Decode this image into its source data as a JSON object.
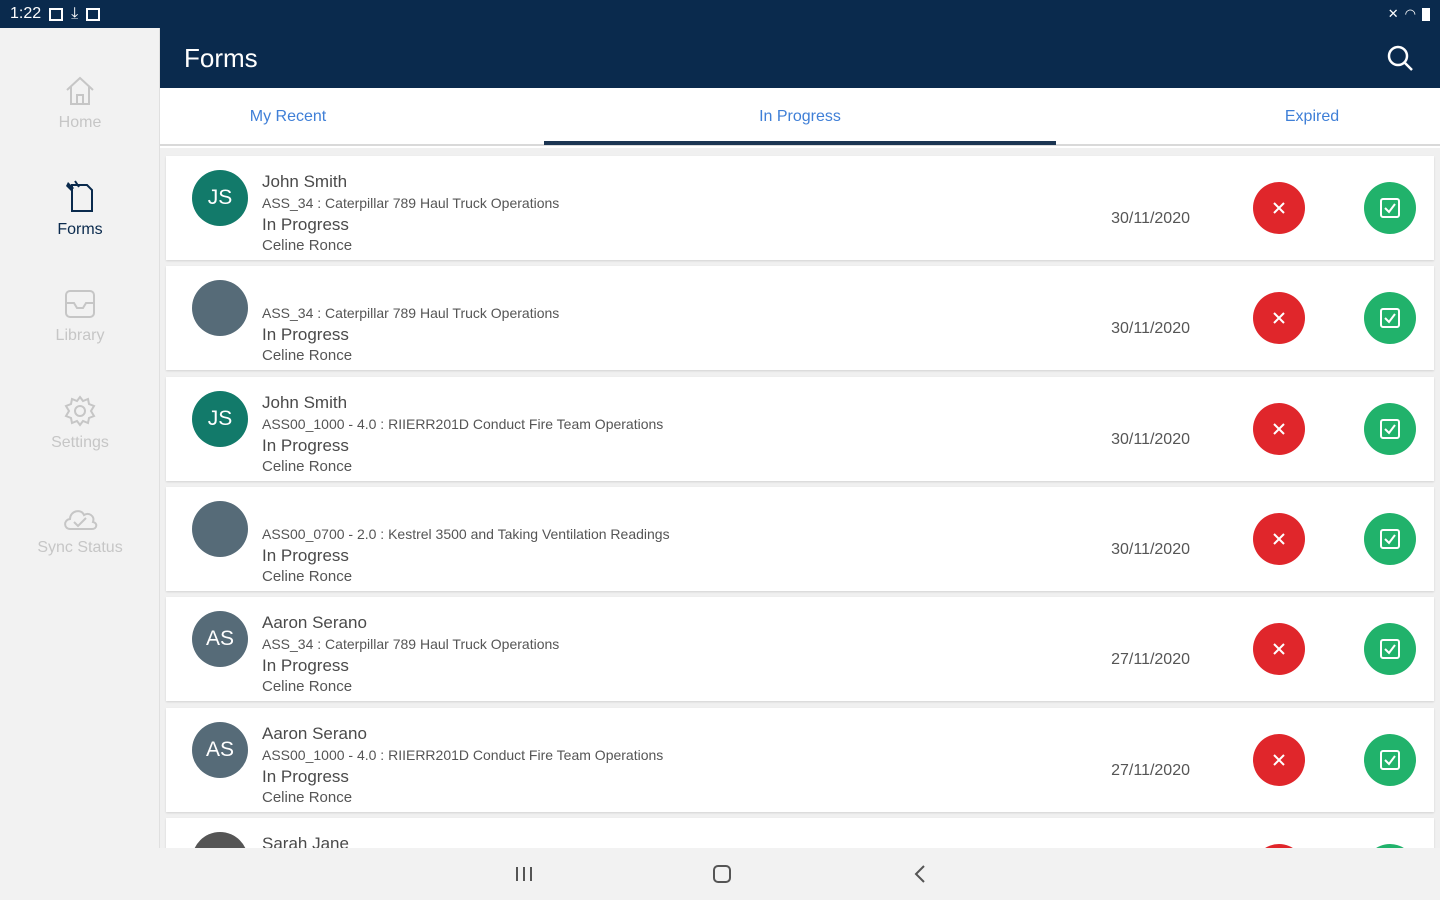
{
  "status_bar": {
    "time": "1:22"
  },
  "sidebar": {
    "items": [
      {
        "label": "Home",
        "icon": "home-icon",
        "active": false
      },
      {
        "label": "Forms",
        "icon": "forms-icon",
        "active": true
      },
      {
        "label": "Library",
        "icon": "library-icon",
        "active": false
      },
      {
        "label": "Settings",
        "icon": "gear-icon",
        "active": false
      },
      {
        "label": "Sync Status",
        "icon": "cloud-icon",
        "active": false
      }
    ]
  },
  "header": {
    "title": "Forms"
  },
  "tabs": [
    {
      "label": "My Recent",
      "active": false
    },
    {
      "label": "In Progress",
      "active": true
    },
    {
      "label": "Expired",
      "active": false
    }
  ],
  "forms": [
    {
      "initials": "JS",
      "name": "John Smith",
      "form": "ASS_34 : Caterpillar 789 Haul Truck Operations",
      "status": "In Progress",
      "owner": "Celine Ronce",
      "date": "30/11/2020",
      "avatar_color": "#127a6a"
    },
    {
      "initials": "",
      "name": "",
      "form": "ASS_34 : Caterpillar 789 Haul Truck Operations",
      "status": "In Progress",
      "owner": "Celine Ronce",
      "date": "30/11/2020",
      "avatar_color": "#566b78"
    },
    {
      "initials": "JS",
      "name": "John Smith",
      "form": "ASS00_1000 - 4.0 : RIIERR201D Conduct Fire Team Operations",
      "status": "In Progress",
      "owner": "Celine Ronce",
      "date": "30/11/2020",
      "avatar_color": "#127a6a"
    },
    {
      "initials": "",
      "name": "",
      "form": "ASS00_0700 - 2.0 : Kestrel 3500 and Taking Ventilation Readings",
      "status": "In Progress",
      "owner": "Celine Ronce",
      "date": "30/11/2020",
      "avatar_color": "#566b78"
    },
    {
      "initials": "AS",
      "name": "Aaron Serano",
      "form": "ASS_34 : Caterpillar 789 Haul Truck Operations",
      "status": "In Progress",
      "owner": "Celine Ronce",
      "date": "27/11/2020",
      "avatar_color": "#566b78"
    },
    {
      "initials": "AS",
      "name": "Aaron Serano",
      "form": "ASS00_1000 - 4.0 : RIIERR201D Conduct Fire Team Operations",
      "status": "In Progress",
      "owner": "Celine Ronce",
      "date": "27/11/2020",
      "avatar_color": "#566b78"
    },
    {
      "initials": "",
      "name": "Sarah Jane",
      "form": "",
      "status": "",
      "owner": "",
      "date": "",
      "avatar_color": "#555555"
    }
  ],
  "colors": {
    "primary": "#0a2a4d",
    "tab_text": "#3f7fd7",
    "delete": "#e0262b",
    "complete": "#21b26b"
  }
}
